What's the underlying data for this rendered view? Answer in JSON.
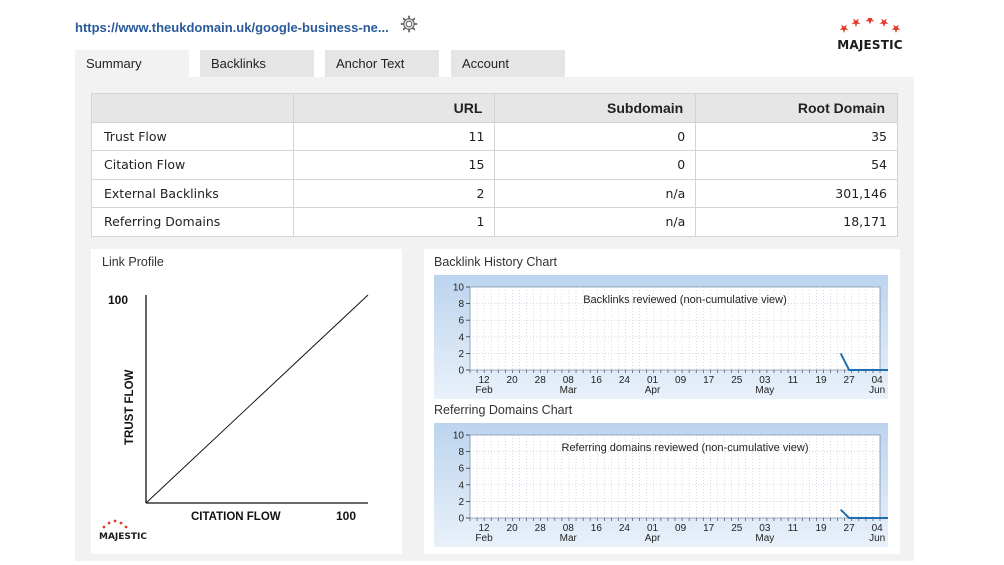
{
  "header": {
    "url_text": "https://www.theukdomain.uk/google-business-ne...",
    "logo_text": "MAJESTIC"
  },
  "tabs": [
    {
      "label": "Summary",
      "active": true
    },
    {
      "label": "Backlinks",
      "active": false
    },
    {
      "label": "Anchor Text",
      "active": false
    },
    {
      "label": "Account",
      "active": false
    }
  ],
  "summary_table": {
    "columns": [
      "",
      "URL",
      "Subdomain",
      "Root Domain"
    ],
    "rows": [
      {
        "label": "Trust Flow",
        "url": "11",
        "subdomain": "0",
        "root": "35"
      },
      {
        "label": "Citation Flow",
        "url": "15",
        "subdomain": "0",
        "root": "54"
      },
      {
        "label": "External Backlinks",
        "url": "2",
        "subdomain": "n/a",
        "root": "301,146"
      },
      {
        "label": "Referring Domains",
        "url": "1",
        "subdomain": "n/a",
        "root": "18,171"
      }
    ]
  },
  "link_profile": {
    "title": "Link Profile",
    "y_label": "TRUST FLOW",
    "x_label": "CITATION FLOW",
    "y_max_label": "100",
    "x_max_label": "100",
    "logo_text": "MAJESTIC"
  },
  "chart_data": [
    {
      "type": "line",
      "title": "Backlink History Chart",
      "annotation": "Backlinks reviewed (non-cumulative view)",
      "ylim": [
        0,
        10
      ],
      "y_ticks": [
        "10",
        "8",
        "6",
        "4",
        "2",
        "0"
      ],
      "x_ticks": [
        {
          "day": "12",
          "month": "Feb"
        },
        {
          "day": "20",
          "month": ""
        },
        {
          "day": "28",
          "month": ""
        },
        {
          "day": "08",
          "month": "Mar"
        },
        {
          "day": "16",
          "month": ""
        },
        {
          "day": "24",
          "month": ""
        },
        {
          "day": "01",
          "month": "Apr"
        },
        {
          "day": "09",
          "month": ""
        },
        {
          "day": "17",
          "month": ""
        },
        {
          "day": "25",
          "month": ""
        },
        {
          "day": "03",
          "month": "May"
        },
        {
          "day": "11",
          "month": ""
        },
        {
          "day": "19",
          "month": ""
        },
        {
          "day": "27",
          "month": ""
        },
        {
          "day": "04",
          "month": "Jun"
        }
      ],
      "series": [
        {
          "values": [
            [
              12.7,
              2
            ],
            [
              13.0,
              0
            ],
            [
              14.9,
              0
            ]
          ]
        }
      ],
      "grid": true,
      "line_color": "#1f6fb0"
    },
    {
      "type": "line",
      "title": "Referring Domains Chart",
      "annotation": "Referring domains reviewed (non-cumulative view)",
      "ylim": [
        0,
        10
      ],
      "y_ticks": [
        "10",
        "8",
        "6",
        "4",
        "2",
        "0"
      ],
      "x_ticks": [
        {
          "day": "12",
          "month": "Feb"
        },
        {
          "day": "20",
          "month": ""
        },
        {
          "day": "28",
          "month": ""
        },
        {
          "day": "08",
          "month": "Mar"
        },
        {
          "day": "16",
          "month": ""
        },
        {
          "day": "24",
          "month": ""
        },
        {
          "day": "01",
          "month": "Apr"
        },
        {
          "day": "09",
          "month": ""
        },
        {
          "day": "17",
          "month": ""
        },
        {
          "day": "25",
          "month": ""
        },
        {
          "day": "03",
          "month": "May"
        },
        {
          "day": "11",
          "month": ""
        },
        {
          "day": "19",
          "month": ""
        },
        {
          "day": "27",
          "month": ""
        },
        {
          "day": "04",
          "month": "Jun"
        }
      ],
      "series": [
        {
          "values": [
            [
              12.7,
              1
            ],
            [
              13.0,
              0
            ],
            [
              14.9,
              0
            ]
          ]
        }
      ],
      "grid": true,
      "line_color": "#1f6fb0"
    }
  ]
}
